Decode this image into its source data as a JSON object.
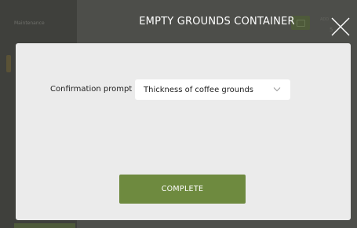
{
  "background": {
    "sidebar_label": "Maintenance",
    "corner_text": "ADD",
    "corner_text2": "5"
  },
  "header": {
    "title": "EMPTY GROUNDS CONTAINER",
    "close_icon": "close-x-icon"
  },
  "modal": {
    "prompt_label": "Confirmation prompt",
    "select": {
      "value": "Thickness of coffee grounds",
      "icon": "chevron-down-icon"
    },
    "complete_label": "COMPLETE"
  },
  "colors": {
    "accent_green": "#6e8a3f",
    "modal_bg": "#ebebeb",
    "overlay_bg": "#4d4e4a"
  }
}
